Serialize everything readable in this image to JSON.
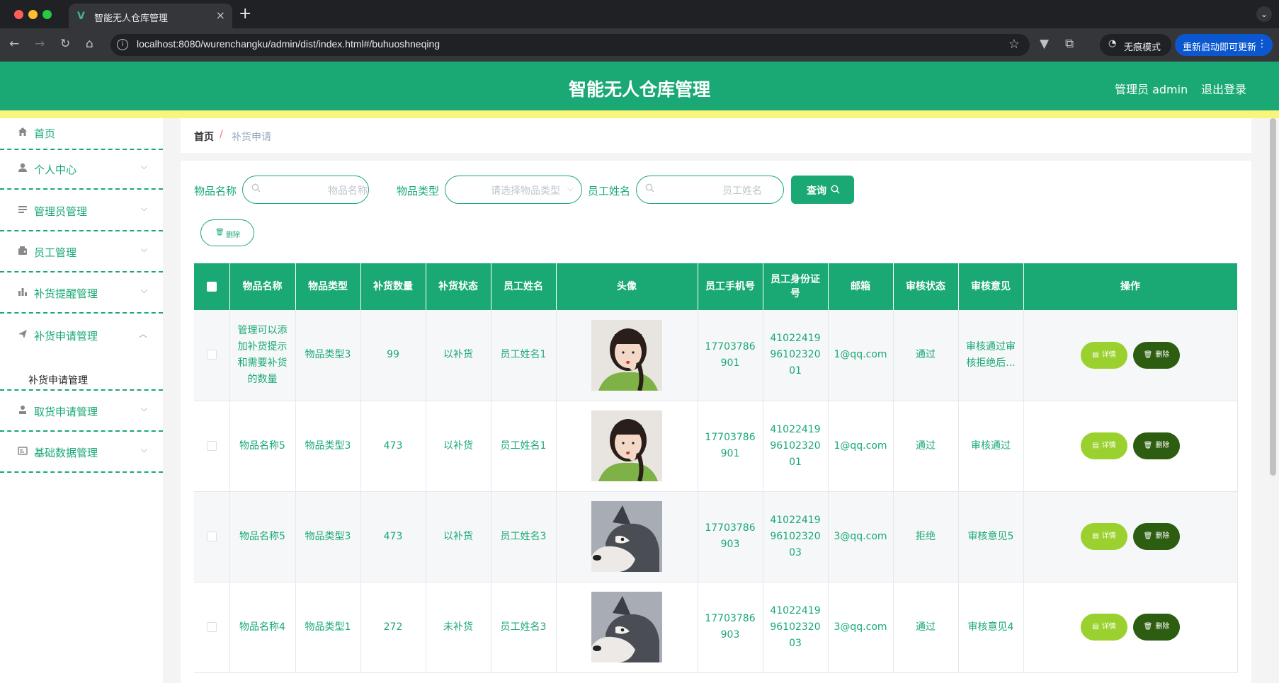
{
  "browser": {
    "tab_title": "智能无人仓库管理",
    "url": "localhost:8080/wurenchangku/admin/dist/index.html#/buhuoshneqing",
    "incognito_label": "无痕模式",
    "restart_label": "重新启动即可更新"
  },
  "header": {
    "title": "智能无人仓库管理",
    "admin_label": "管理员 admin",
    "logout_label": "退出登录"
  },
  "sidebar": {
    "items": [
      {
        "label": "首页",
        "icon": "home-icon"
      },
      {
        "label": "个人中心",
        "icon": "user-icon"
      },
      {
        "label": "管理员管理",
        "icon": "list-icon"
      },
      {
        "label": "员工管理",
        "icon": "wallet-icon"
      },
      {
        "label": "补货提醒管理",
        "icon": "bar-chart-icon"
      },
      {
        "label": "补货申请管理",
        "icon": "send-icon"
      },
      {
        "label": "取货申请管理",
        "icon": "user-pickup-icon"
      },
      {
        "label": "基础数据管理",
        "icon": "card-icon"
      }
    ],
    "sub_item": "补货申请管理"
  },
  "breadcrumb": {
    "home": "首页",
    "separator": "/",
    "current": "补货申请"
  },
  "search": {
    "item_name_label": "物品名称",
    "item_name_placeholder": "物品名称",
    "item_type_label": "物品类型",
    "item_type_placeholder": "请选择物品类型",
    "employee_name_label": "员工姓名",
    "employee_name_placeholder": "员工姓名",
    "query_label": "查询",
    "delete_label": "删除"
  },
  "table": {
    "headers": [
      "物品名称",
      "物品类型",
      "补货数量",
      "补货状态",
      "员工姓名",
      "头像",
      "员工手机号",
      "员工身份证号",
      "邮箱",
      "审核状态",
      "审核意见",
      "操作"
    ],
    "detail_label": "详情",
    "delete_label": "删除",
    "rows": [
      {
        "name": "管理可以添加补货提示和需要补货的数量",
        "type": "物品类型3",
        "qty": "99",
        "status": "以补货",
        "employee": "员工姓名1",
        "avatar": "girl",
        "phone": "17703786901",
        "idcard": "410224199610232001",
        "email": "1@qq.com",
        "audit": "通过",
        "opinion": "审核通过审核拒绝后..."
      },
      {
        "name": "物品名称5",
        "type": "物品类型3",
        "qty": "473",
        "status": "以补货",
        "employee": "员工姓名1",
        "avatar": "girl",
        "phone": "17703786901",
        "idcard": "410224199610232001",
        "email": "1@qq.com",
        "audit": "通过",
        "opinion": "审核通过"
      },
      {
        "name": "物品名称5",
        "type": "物品类型3",
        "qty": "473",
        "status": "以补货",
        "employee": "员工姓名3",
        "avatar": "husky",
        "phone": "17703786903",
        "idcard": "410224199610232003",
        "email": "3@qq.com",
        "audit": "拒绝",
        "opinion": "审核意见5"
      },
      {
        "name": "物品名称4",
        "type": "物品类型1",
        "qty": "272",
        "status": "未补货",
        "employee": "员工姓名3",
        "avatar": "husky",
        "phone": "17703786903",
        "idcard": "410224199610232003",
        "email": "3@qq.com",
        "audit": "通过",
        "opinion": "审核意见4"
      }
    ]
  },
  "colors": {
    "primary": "#1aa974",
    "accent_yellow": "#f8f57a",
    "detail_button": "#9bd12e",
    "delete_button": "#2d5d10"
  }
}
